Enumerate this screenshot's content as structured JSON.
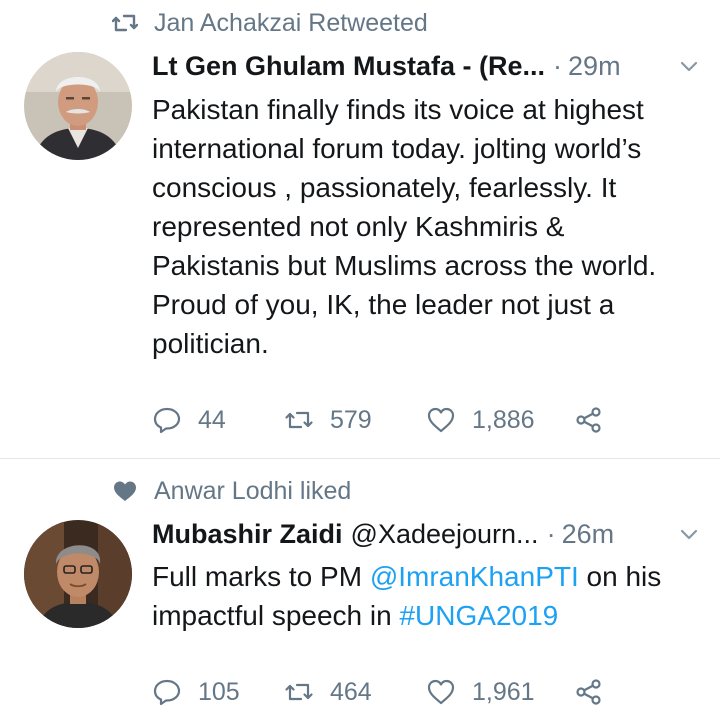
{
  "tweets": [
    {
      "social_context": "Jan Achakzai Retweeted",
      "social_icon": "retweet-icon",
      "author_name": "Lt Gen Ghulam Mustafa - (Re...",
      "author_handle": "",
      "time": "29m",
      "text_lines": [
        "Pakistan finally finds its voice at highest",
        "international forum today. jolting world’s",
        "conscious , passionately, fearlessly. It",
        "represented not only Kashmiris &",
        "Pakistanis but Muslims across the world.",
        "Proud of you, IK, the leader not just a",
        "politician."
      ],
      "replies": "44",
      "retweets": "579",
      "likes": "1,886"
    },
    {
      "social_context": "Anwar Lodhi liked",
      "social_icon": "heart-filled-icon",
      "author_name": "Mubashir Zaidi",
      "author_handle": "@Xadeejourn...",
      "time": "26m",
      "text_line1_prefix": "Full marks to PM ",
      "text_line1_mention": "@ImranKhanPTI",
      "text_line1_suffix": " on his",
      "text_line2_prefix": "impactful speech in ",
      "text_line2_hashtag": "#UNGA2019",
      "replies": "105",
      "retweets": "464",
      "likes": "1,961"
    }
  ],
  "colors": {
    "text": "#14171a",
    "secondary": "#657786",
    "link": "#1da1f2",
    "divider": "#e1e8ed"
  },
  "separator": "·"
}
